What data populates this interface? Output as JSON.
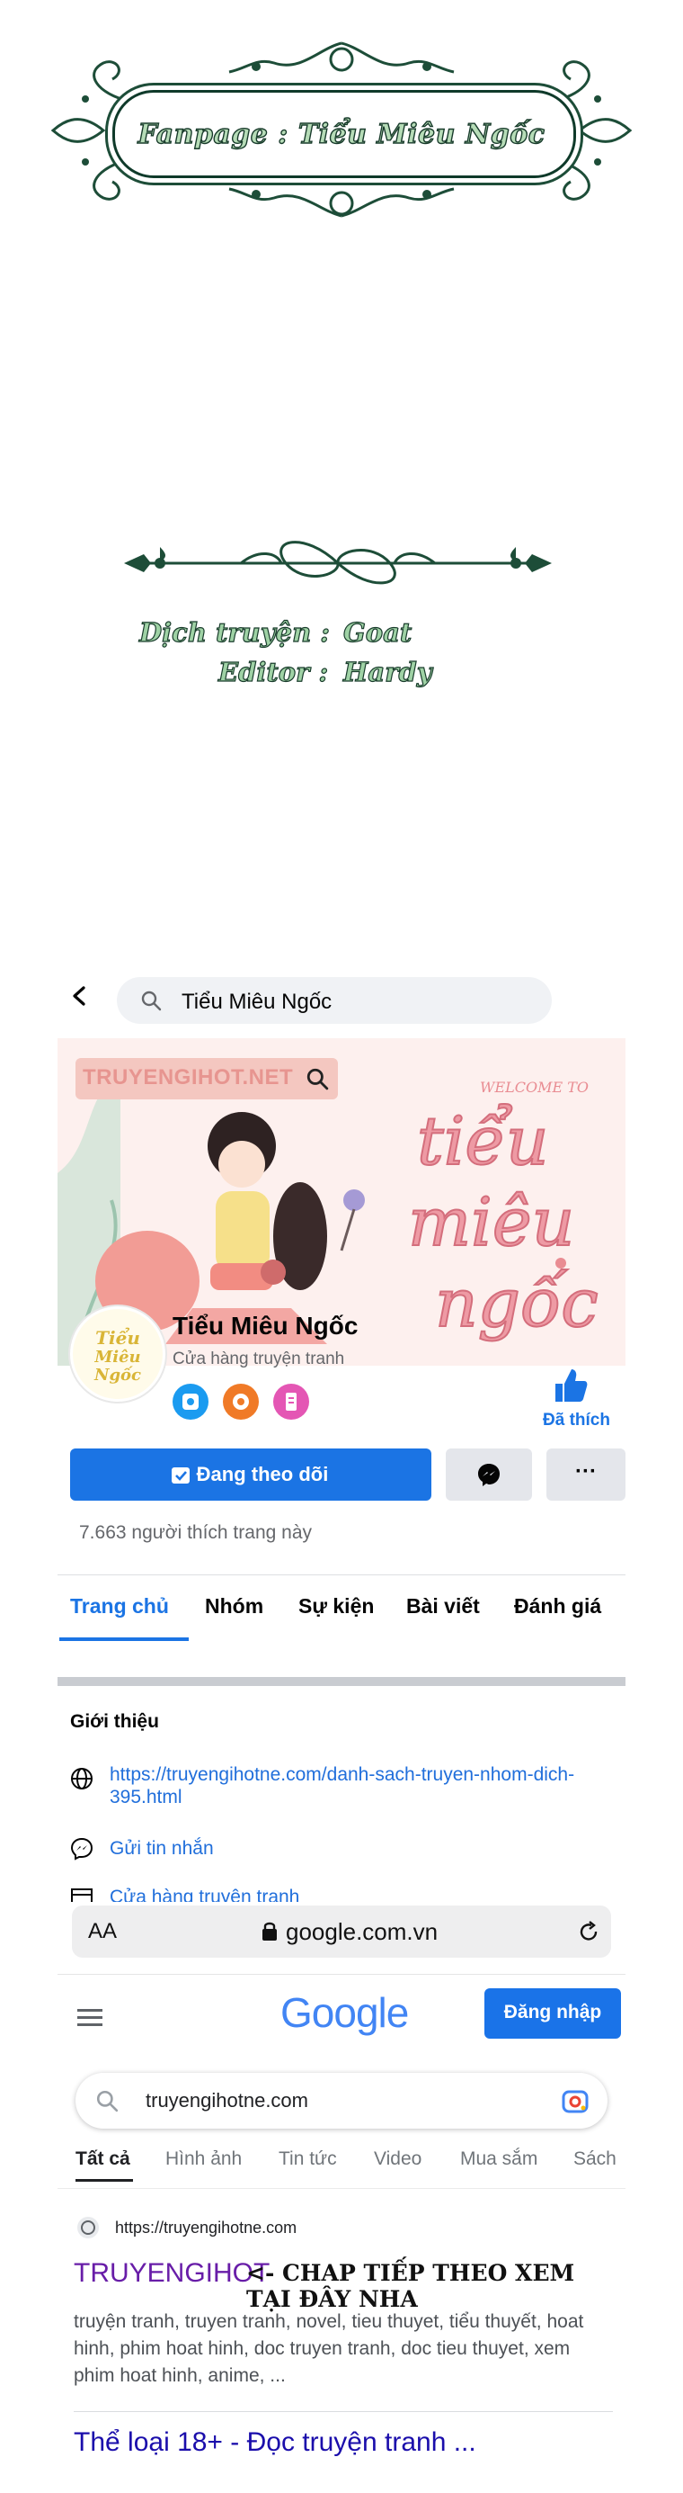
{
  "header_ornament": {
    "fanpage_text": "Fanpage : Tiểu Miêu Ngốc"
  },
  "credits": {
    "translator_label": "Dịch truyện :",
    "translator_name": "Goat",
    "editor_label": "Editor :",
    "editor_name": "Hardy"
  },
  "facebook": {
    "search_query": "Tiểu Miêu Ngốc",
    "cover_watermark": "TRUYENGIHOT.NET",
    "page_name": "Tiểu Miêu Ngốc",
    "page_category": "Cửa hàng truyện tranh",
    "liked_label": "Đã thích",
    "follow_button": "Đang theo dõi",
    "more_label": "···",
    "likes_text": "7.663 người thích trang này",
    "tabs": [
      "Trang chủ",
      "Nhóm",
      "Sự kiện",
      "Bài viết",
      "Đánh giá"
    ],
    "intro_title": "Giới thiệu",
    "website_link": "https://truyengihotne.com/danh-sach-truyen-nhom-dich-395.html",
    "message_link": "Gửi tin nhắn",
    "shop_link": "Cửa hàng truyện tranh"
  },
  "browser": {
    "text_size": "AA",
    "url": "google.com.vn"
  },
  "google": {
    "logo": "Google",
    "sign_in": "Đăng nhập",
    "query": "truyengihotne.com",
    "tabs": [
      "Tất cả",
      "Hình ảnh",
      "Tin tức",
      "Video",
      "Mua sắm",
      "Sách"
    ],
    "result_url": "https://truyengihotne.com",
    "result_title": "TRUYENGIHOT",
    "result_title_overlay": "<- CHAP TIẾP THEO XEM TẠI ĐÂY NHA",
    "result_snippet": "truyện tranh, truyen tranh, novel, tieu thuyet, tiểu thuyết, hoat hinh, phim hoat hinh, doc truyen tranh, doc tieu thuyet, xem phim hoat hinh, anime, ...",
    "result2_title": "Thể loại 18+ - Đọc truyện tranh ..."
  },
  "colors": {
    "facebook_blue": "#1b74e4",
    "google_blue": "#1a73e8",
    "ornament_green": "#1d4d38",
    "visited_link": "#681da8"
  }
}
